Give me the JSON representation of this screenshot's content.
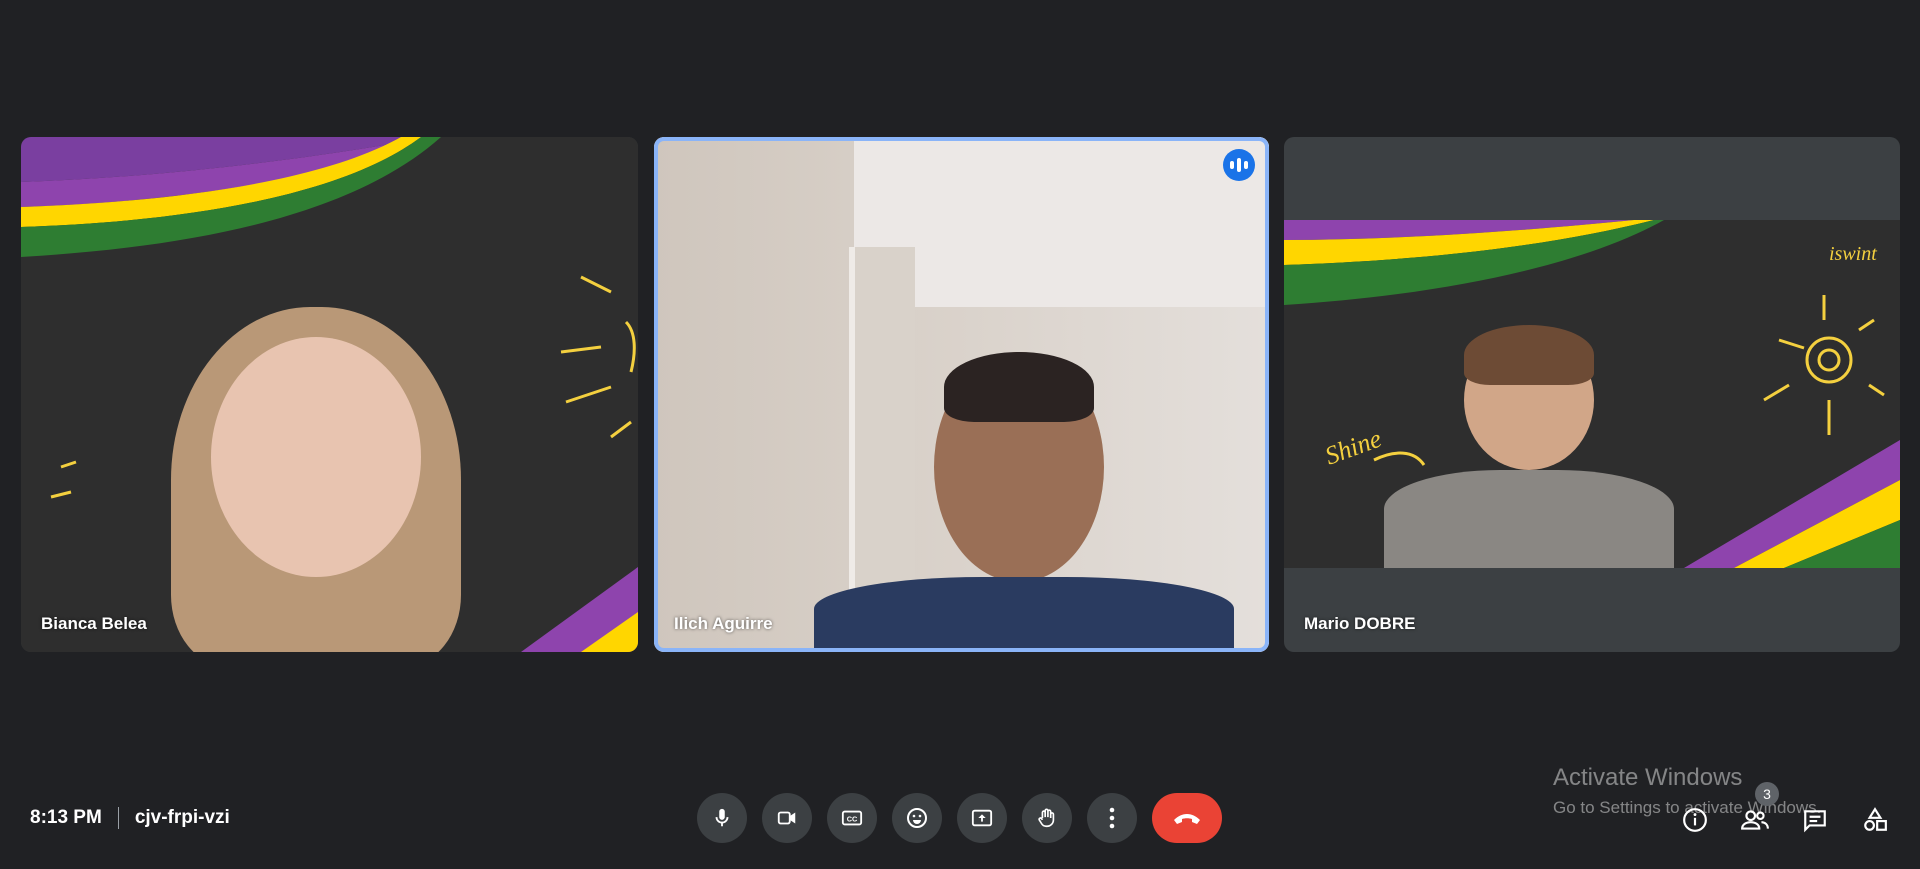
{
  "participants": [
    {
      "name": "Bianca Belea"
    },
    {
      "name": "Ilich Aguirre"
    },
    {
      "name": "Mario DOBRE"
    }
  ],
  "meeting": {
    "time": "8:13 PM",
    "code": "cjv-frpi-vzi"
  },
  "controls": [
    {
      "name": "microphone",
      "icon": "mic-icon"
    },
    {
      "name": "camera",
      "icon": "camera-icon"
    },
    {
      "name": "captions",
      "icon": "cc-icon"
    },
    {
      "name": "reactions",
      "icon": "emoji-icon"
    },
    {
      "name": "present",
      "icon": "present-icon"
    },
    {
      "name": "raise-hand",
      "icon": "hand-icon"
    },
    {
      "name": "more-options",
      "icon": "more-icon"
    },
    {
      "name": "leave-call",
      "icon": "phone-end-icon"
    }
  ],
  "right_panel": {
    "people_count": "3"
  },
  "watermark": {
    "title": "Activate Windows",
    "subtitle": "Go to Settings to activate Windows."
  },
  "colors": {
    "background": "#202124",
    "button": "#3c4043",
    "end_call": "#ea4335",
    "active_speaker": "#8ab4f8"
  }
}
